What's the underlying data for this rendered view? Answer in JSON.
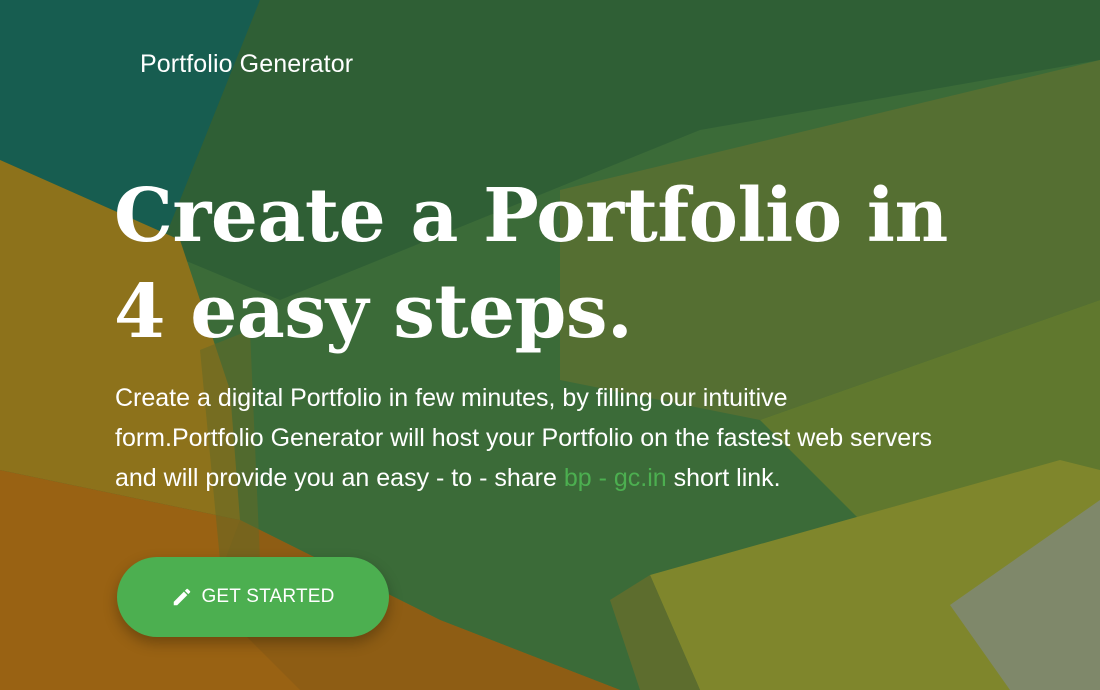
{
  "header": {
    "brand": "Portfolio Generator"
  },
  "hero": {
    "headline_line1": "Create a Portfolio in",
    "headline_line2": "4 easy steps.",
    "lead_before_link": "Create a digital Portfolio in few minutes, by filling our intuitive form.Portfolio Generator will host your Portfolio on the fastest web servers and will provide you an easy - to - share ",
    "lead_link": "bp - gc.in",
    "lead_after_link": " short link.",
    "cta_label": "GET STARTED",
    "cta_icon": "pencil-icon"
  },
  "colors": {
    "accent": "#4caf50",
    "text": "#ffffff"
  }
}
